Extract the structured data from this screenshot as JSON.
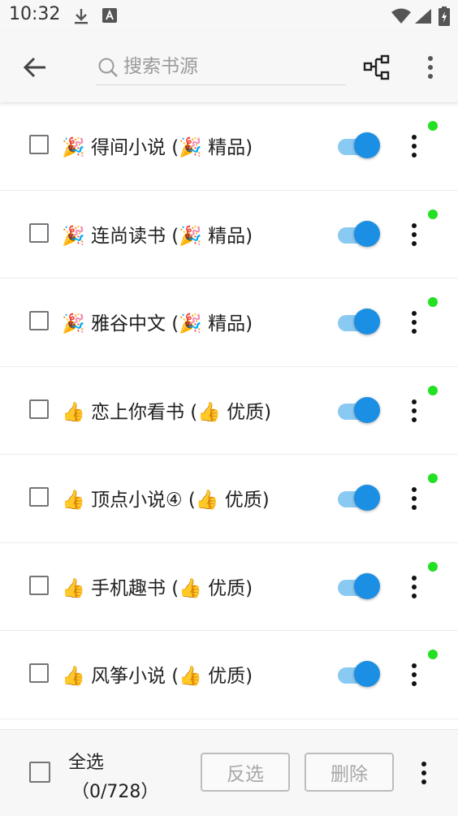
{
  "status_bar": {
    "time": "10:32",
    "icons": [
      "download-icon",
      "a-badge-icon",
      "wifi-icon",
      "signal-icon",
      "battery-icon"
    ]
  },
  "toolbar": {
    "search_placeholder": "搜索书源",
    "search_value": ""
  },
  "colors": {
    "switch_on": "#1a8fe3",
    "switch_track": "#8ac9f2",
    "status_dot": "#22e022"
  },
  "sources": [
    {
      "name": "🎉 得间小说 (🎉 精品)",
      "enabled": true
    },
    {
      "name": "🎉 连尚读书 (🎉 精品)",
      "enabled": true
    },
    {
      "name": "🎉 雅谷中文 (🎉 精品)",
      "enabled": true
    },
    {
      "name": "👍 恋上你看书 (👍 优质)",
      "enabled": true
    },
    {
      "name": "👍 顶点小说④ (👍 优质)",
      "enabled": true
    },
    {
      "name": "👍 手机趣书 (👍 优质)",
      "enabled": true
    },
    {
      "name": "👍 风筝小说 (👍 优质)",
      "enabled": true
    }
  ],
  "bottom_bar": {
    "select_all_label": "全选",
    "count_text": "（0/728）",
    "invert_label": "反选",
    "delete_label": "删除"
  }
}
